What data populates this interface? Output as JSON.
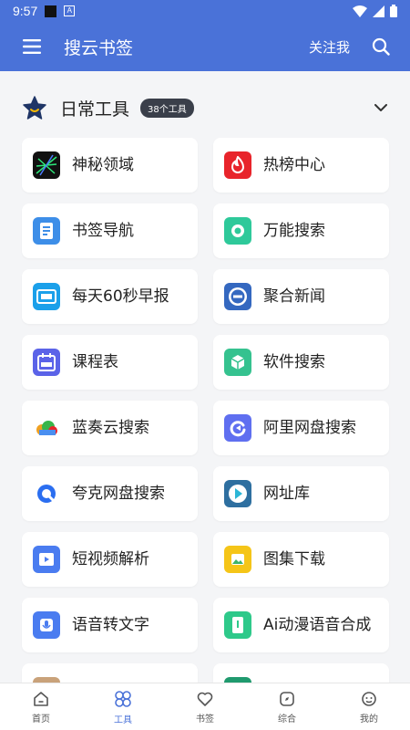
{
  "status": {
    "time": "9:57",
    "a_glyph": "A"
  },
  "header": {
    "title": "搜云书签",
    "follow": "关注我"
  },
  "section": {
    "title": "日常工具",
    "badge": "38个工具"
  },
  "tools": [
    {
      "label": "神秘领域",
      "icon": "mystic-domain-icon",
      "color": "#111111"
    },
    {
      "label": "热榜中心",
      "icon": "fire-icon",
      "color": "#e8242b"
    },
    {
      "label": "书签导航",
      "icon": "bookmark-nav-icon",
      "color": "#3d8ee8"
    },
    {
      "label": "万能搜索",
      "icon": "search-bubble-icon",
      "color": "#2ec99a"
    },
    {
      "label": "每天60秒早报",
      "icon": "news-60s-icon",
      "color": "#1ba0ea"
    },
    {
      "label": "聚合新闻",
      "icon": "news-circle-icon",
      "color": "#3468c0"
    },
    {
      "label": "课程表",
      "icon": "calendar-icon",
      "color": "#5b63e8"
    },
    {
      "label": "软件搜索",
      "icon": "cube-icon",
      "color": "#35c28f"
    },
    {
      "label": "蓝奏云搜索",
      "icon": "cloud-icon",
      "color": "#f0a020"
    },
    {
      "label": "阿里网盘搜索",
      "icon": "aliyun-drive-icon",
      "color": "#5f6ff0"
    },
    {
      "label": "夸克网盘搜索",
      "icon": "quark-icon",
      "color": "#2b6ef0"
    },
    {
      "label": "网址库",
      "icon": "url-library-icon",
      "color": "#2e6fa0"
    },
    {
      "label": "短视频解析",
      "icon": "video-icon",
      "color": "#4a7cf0"
    },
    {
      "label": "图集下载",
      "icon": "image-download-icon",
      "color": "#f5c518"
    },
    {
      "label": "语音转文字",
      "icon": "voice-text-icon",
      "color": "#4a7cf0"
    },
    {
      "label": "Ai动漫语音合成",
      "icon": "ai-voice-icon",
      "color": "#2ec98a"
    },
    {
      "label": "",
      "icon": "partial-icon-1",
      "color": "#c9a27a"
    },
    {
      "label": "",
      "icon": "partial-icon-2",
      "color": "#1f9a6e"
    }
  ],
  "nav": [
    {
      "label": "首页",
      "icon": "home-icon"
    },
    {
      "label": "工具",
      "icon": "tools-clover-icon"
    },
    {
      "label": "书签",
      "icon": "heart-icon"
    },
    {
      "label": "综合",
      "icon": "compass-icon"
    },
    {
      "label": "我的",
      "icon": "profile-icon"
    }
  ],
  "colors": {
    "primary": "#4a72d8",
    "background": "#f4f5f7",
    "card": "#ffffff"
  }
}
